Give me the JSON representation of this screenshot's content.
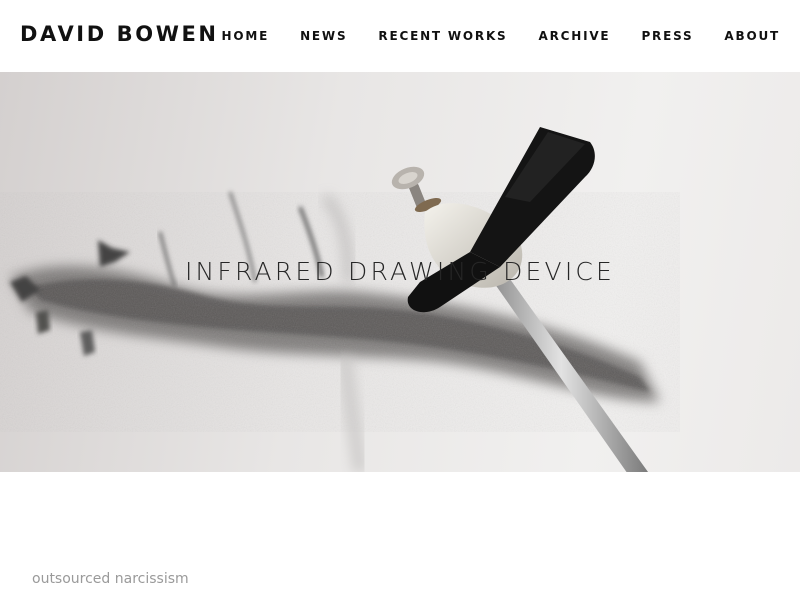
{
  "site": {
    "title": "DAVID BOWEN"
  },
  "nav": {
    "items": [
      {
        "label": "HOME"
      },
      {
        "label": "NEWS"
      },
      {
        "label": "RECENT WORKS"
      },
      {
        "label": "ARCHIVE"
      },
      {
        "label": "PRESS"
      },
      {
        "label": "ABOUT"
      }
    ]
  },
  "hero": {
    "title": "INFRARED DRAWING DEVICE",
    "image": "charcoal-drawing-device-photo"
  },
  "content": {
    "subtitle": "outsourced narcissism"
  }
}
